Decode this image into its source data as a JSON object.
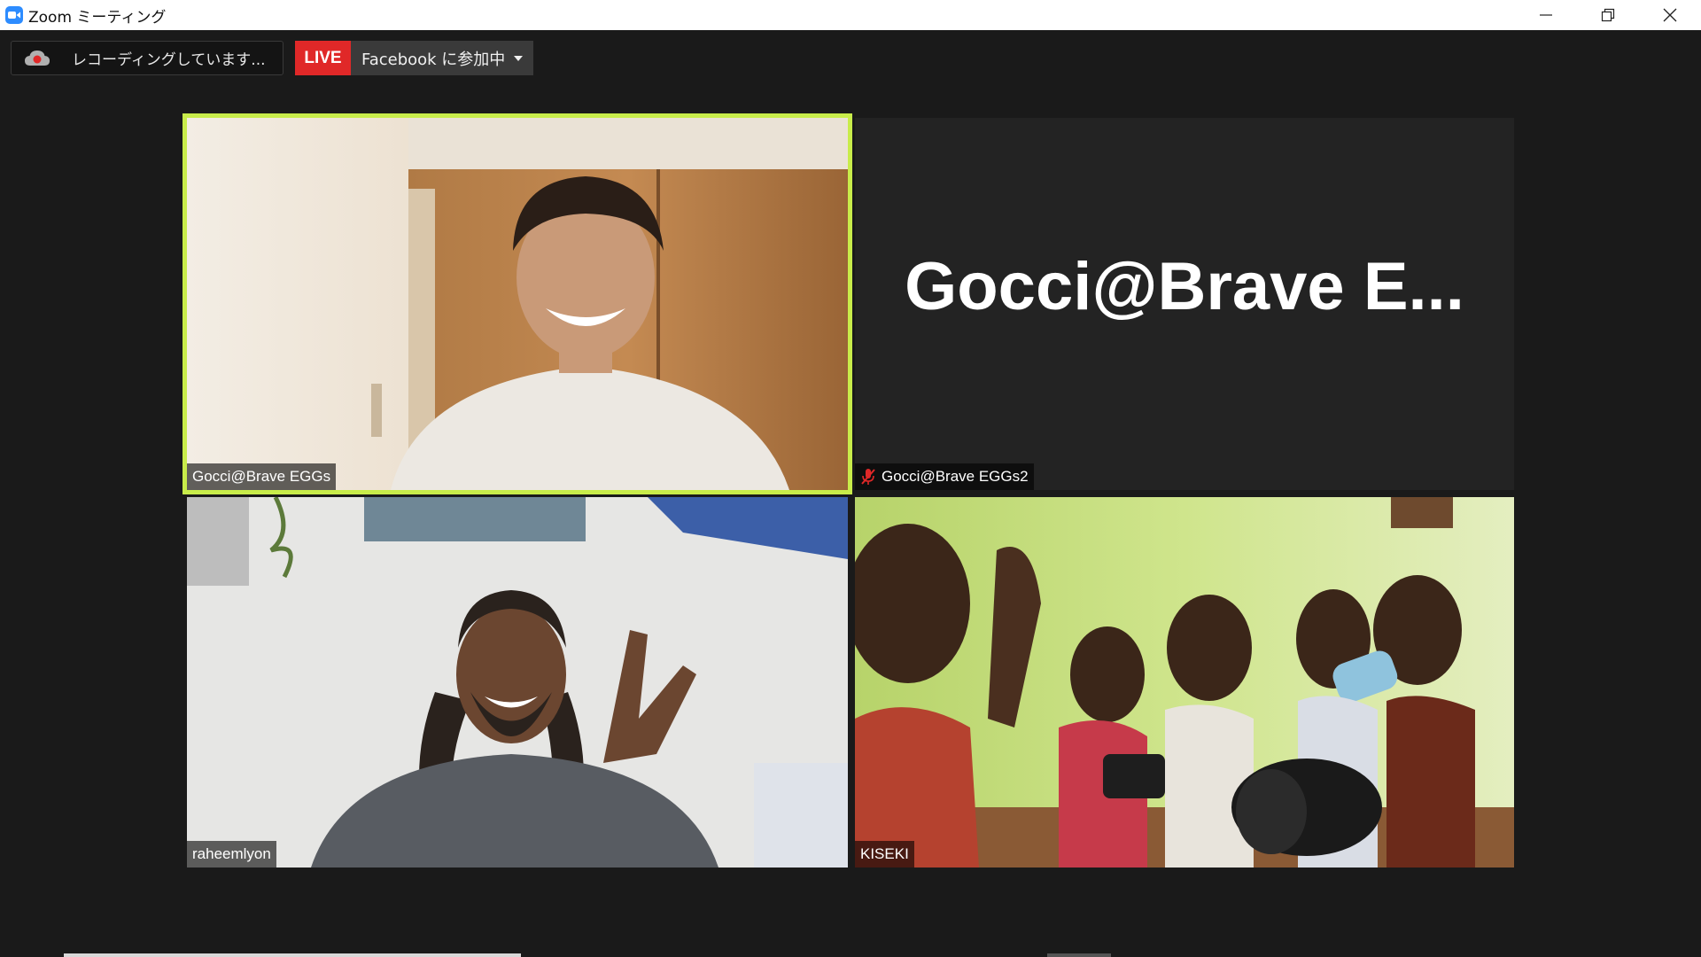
{
  "window": {
    "title": "Zoom ミーティング"
  },
  "status": {
    "recording_text": "レコーディングしています...",
    "live_label": "LIVE",
    "live_dropdown_label": "Facebook に参加中"
  },
  "participants": [
    {
      "name": "Gocci@Brave EGGs",
      "video": true,
      "active_speaker": true
    },
    {
      "name": "Gocci@Brave EGGs2",
      "video": false,
      "display_text": "Gocci@Brave  E...",
      "muted": true
    },
    {
      "name": "raheemlyon",
      "video": true
    },
    {
      "name": "KISEKI",
      "video": true
    }
  ],
  "colors": {
    "active_speaker_border": "#c8ec4a",
    "live_badge": "#e02828",
    "zoom_blue": "#2d8cff",
    "muted_icon": "#e02828"
  }
}
